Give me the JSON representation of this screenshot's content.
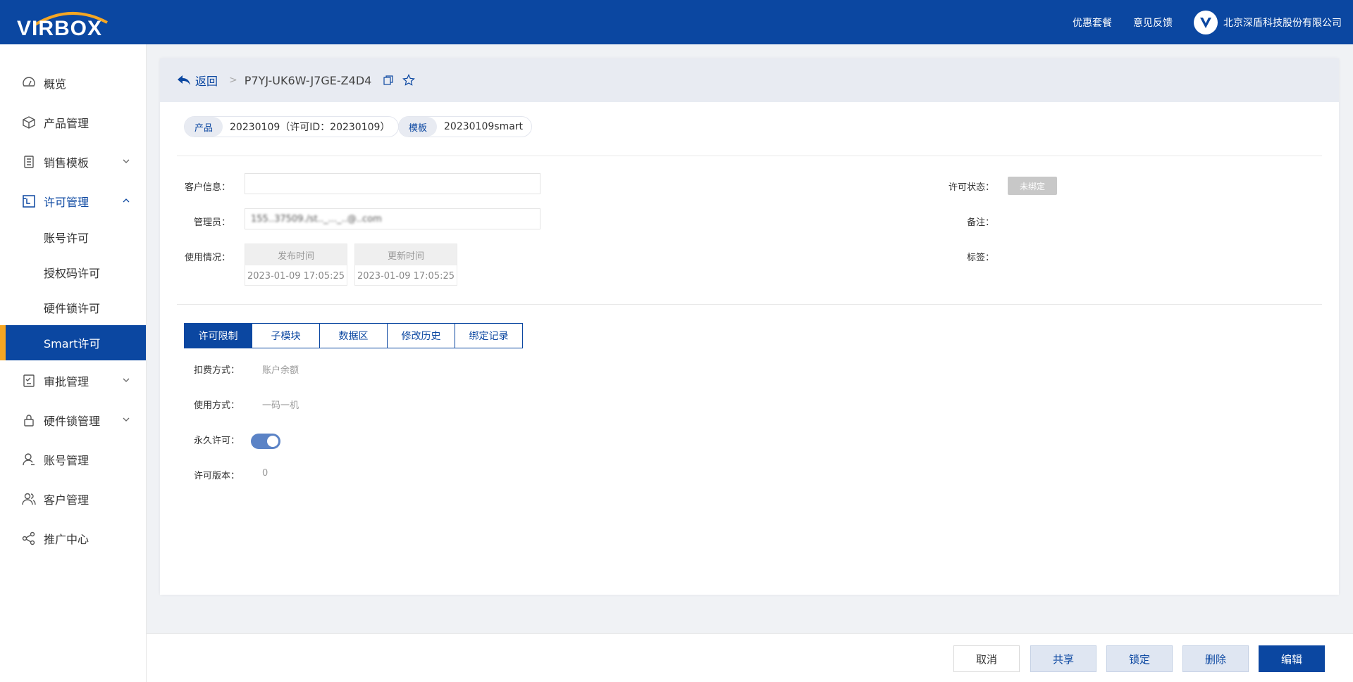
{
  "header": {
    "logo_text": "VIRBOX",
    "links": [
      "优惠套餐",
      "意见反馈"
    ],
    "company": "北京深盾科技股份有限公司"
  },
  "sidebar": {
    "items": [
      {
        "label": "概览",
        "icon": "dashboard-icon"
      },
      {
        "label": "产品管理",
        "icon": "box-icon"
      },
      {
        "label": "销售模板",
        "icon": "document-icon",
        "expandable": true
      },
      {
        "label": "许可管理",
        "icon": "license-icon",
        "expandable": true,
        "open": true
      },
      {
        "label": "审批管理",
        "icon": "approval-icon",
        "expandable": true
      },
      {
        "label": "硬件锁管理",
        "icon": "lock-icon",
        "expandable": true
      },
      {
        "label": "账号管理",
        "icon": "user-icon"
      },
      {
        "label": "客户管理",
        "icon": "users-icon"
      },
      {
        "label": "推广中心",
        "icon": "share-icon"
      }
    ],
    "sub_items": [
      "账号许可",
      "授权码许可",
      "硬件锁许可",
      "Smart许可"
    ],
    "active_sub": "Smart许可"
  },
  "crumb": {
    "back": "返回",
    "title": "P7YJ-UK6W-J7GE-Z4D4"
  },
  "tags": {
    "product_key": "产品",
    "product_val": "20230109（许可ID：20230109）",
    "template_key": "模板",
    "template_val": "20230109smart"
  },
  "info": {
    "customer_label": "客户信息：",
    "customer_value": "",
    "admin_label": "管理员：",
    "admin_value": "155..37509./st.._..._..@..com",
    "usage_label": "使用情况：",
    "publish_head": "发布时间",
    "publish_time": "2023-01-09 17:05:25",
    "update_head": "更新时间",
    "update_time": "2023-01-09 17:05:25",
    "status_label": "许可状态：",
    "status_value": "未绑定",
    "remark_label": "备注：",
    "tag_label": "标签："
  },
  "tabs": [
    "许可限制",
    "子模块",
    "数据区",
    "修改历史",
    "绑定记录"
  ],
  "limits": {
    "billing_label": "扣费方式：",
    "billing_value": "账户余额",
    "usage_mode_label": "使用方式：",
    "usage_mode_value": "一码一机",
    "permanent_label": "永久许可：",
    "permanent_on": true,
    "version_label": "许可版本：",
    "version_value": "0"
  },
  "footer": {
    "cancel": "取消",
    "share": "共享",
    "lock": "锁定",
    "delete": "删除",
    "edit": "编辑"
  },
  "colors": {
    "brand": "#0b47a1",
    "accent": "#f5a623"
  }
}
